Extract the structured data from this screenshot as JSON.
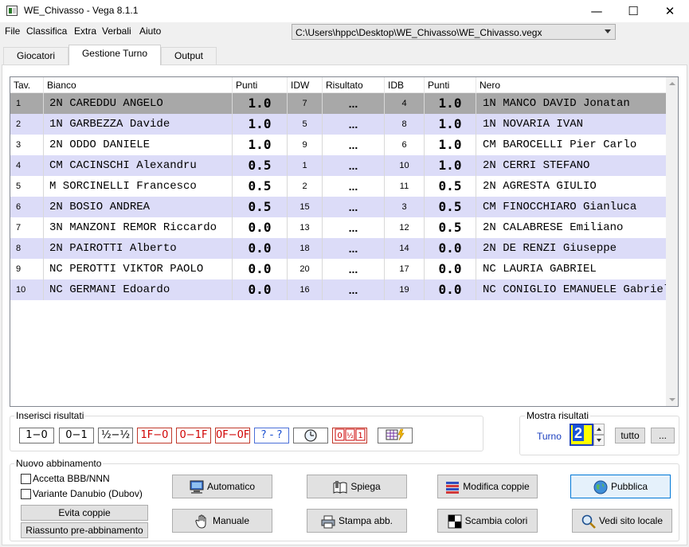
{
  "window": {
    "title": "WE_Chivasso - Vega 8.1.1",
    "minimize": "—",
    "maximize": "☐",
    "close": "✕"
  },
  "menu": [
    "File",
    "Classifica",
    "Extra",
    "Verbali",
    "Aiuto"
  ],
  "file_path": "C:\\Users\\hppc\\Desktop\\WE_Chivasso\\WE_Chivasso.vegx",
  "tabs": [
    "Giocatori",
    "Gestione Turno",
    "Output"
  ],
  "active_tab": 1,
  "table": {
    "headers": [
      "Tav.",
      "Bianco",
      "Punti",
      "IDW",
      "Risultato",
      "IDB",
      "Punti",
      "Nero"
    ],
    "rows": [
      {
        "tav": "1",
        "bianco": "2N CAREDDU ANGELO",
        "punti_w": "1.0",
        "idw": "7",
        "ris": "...",
        "idb": "4",
        "punti_b": "1.0",
        "nero": "1N MANCO DAVID Jonatan"
      },
      {
        "tav": "2",
        "bianco": "1N GARBEZZA Davide",
        "punti_w": "1.0",
        "idw": "5",
        "ris": "...",
        "idb": "8",
        "punti_b": "1.0",
        "nero": "1N NOVARIA IVAN"
      },
      {
        "tav": "3",
        "bianco": "2N ODDO DANIELE",
        "punti_w": "1.0",
        "idw": "9",
        "ris": "...",
        "idb": "6",
        "punti_b": "1.0",
        "nero": "CM BAROCELLI Pier Carlo"
      },
      {
        "tav": "4",
        "bianco": "CM CACINSCHI Alexandru",
        "punti_w": "0.5",
        "idw": "1",
        "ris": "...",
        "idb": "10",
        "punti_b": "1.0",
        "nero": "2N CERRI STEFANO"
      },
      {
        "tav": "5",
        "bianco": "M SORCINELLI Francesco",
        "punti_w": "0.5",
        "idw": "2",
        "ris": "...",
        "idb": "11",
        "punti_b": "0.5",
        "nero": "2N AGRESTA GIULIO"
      },
      {
        "tav": "6",
        "bianco": "2N BOSIO ANDREA",
        "punti_w": "0.5",
        "idw": "15",
        "ris": "...",
        "idb": "3",
        "punti_b": "0.5",
        "nero": "CM FINOCCHIARO Gianluca"
      },
      {
        "tav": "7",
        "bianco": "3N MANZONI REMOR Riccardo",
        "punti_w": "0.0",
        "idw": "13",
        "ris": "...",
        "idb": "12",
        "punti_b": "0.5",
        "nero": "2N CALABRESE Emiliano"
      },
      {
        "tav": "8",
        "bianco": "2N PAIROTTI Alberto",
        "punti_w": "0.0",
        "idw": "18",
        "ris": "...",
        "idb": "14",
        "punti_b": "0.0",
        "nero": "2N DE RENZI Giuseppe"
      },
      {
        "tav": "9",
        "bianco": "NC PEROTTI VIKTOR PAOLO",
        "punti_w": "0.0",
        "idw": "20",
        "ris": "...",
        "idb": "17",
        "punti_b": "0.0",
        "nero": "NC LAURIA GABRIEL"
      },
      {
        "tav": "10",
        "bianco": "NC GERMANI Edoardo",
        "punti_w": "0.0",
        "idw": "16",
        "ris": "...",
        "idb": "19",
        "punti_b": "0.0",
        "nero": "NC CONIGLIO EMANUELE Gabriele"
      }
    ]
  },
  "insert_results": {
    "label": "Inserisci risultati",
    "buttons": [
      "1−0",
      "0−1",
      "½−½",
      "1F−0",
      "0−1F",
      "0F−0F",
      "? - ?"
    ]
  },
  "show_results": {
    "label": "Mostra risultati",
    "turno_label": "Turno",
    "turno_value": "2",
    "tutto_label": "tutto",
    "more_label": "..."
  },
  "pairing": {
    "label": "Nuovo abbinamento",
    "check_bbb": "Accetta BBB/NNN",
    "check_dubov": "Variante Danubio (Dubov)",
    "evita_coppie": "Evita coppie",
    "riassunto": "Riassunto pre-abbinamento",
    "automatico": "Automatico",
    "manuale": "Manuale",
    "spiega": "Spiega",
    "stampa": "Stampa abb.",
    "modifica": "Modifica coppie",
    "scambia": "Scambia colori",
    "pubblica": "Pubblica",
    "vedi_sito": "Vedi sito locale"
  },
  "colors": {
    "row_even": "#dcdcf8",
    "row_selected": "#a8a8a8",
    "turno_bg": "#ffff00",
    "accent_blue": "#1a3fbf",
    "result_red": "#d00000"
  }
}
